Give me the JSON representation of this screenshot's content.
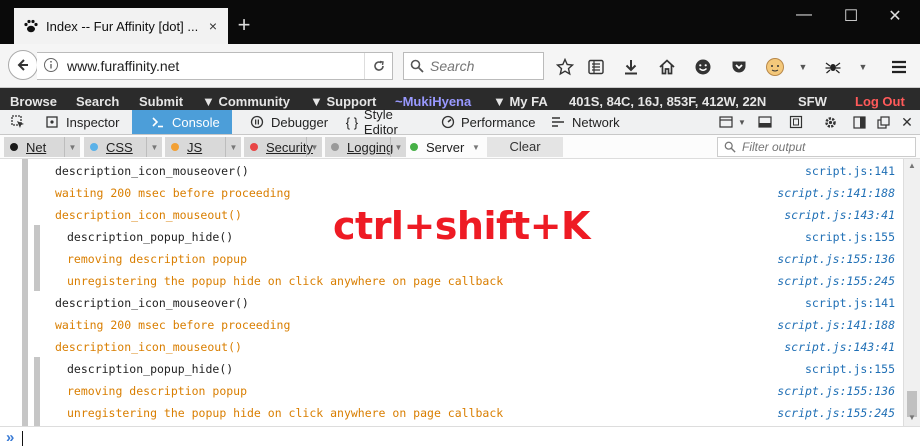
{
  "browser": {
    "tab_title": "Index -- Fur Affinity [dot] ...",
    "tab_close": "×",
    "new_tab": "+",
    "window_controls": {
      "minimize": "—",
      "maximize": "☐",
      "close": "✕"
    },
    "url": "www.furaffinity.net",
    "search_placeholder": "Search"
  },
  "site_menu": {
    "items": [
      "Browse",
      "Search",
      "Submit",
      "▼ Community",
      "▼ Support"
    ],
    "username": "~MukiHyena",
    "my_fa": "▼ My FA",
    "stats": "401S, 84C, 16J, 853F, 412W, 22N",
    "rating": "SFW",
    "logout": "Log Out"
  },
  "devtools": {
    "tabs": [
      {
        "label": "Inspector",
        "icon": "inspector-icon"
      },
      {
        "label": "Console",
        "icon": "console-icon",
        "active": true
      },
      {
        "label": "Debugger",
        "icon": "debugger-icon"
      },
      {
        "label": "Style Editor",
        "icon": "style-editor-icon"
      },
      {
        "label": "Performance",
        "icon": "performance-icon"
      },
      {
        "label": "Network",
        "icon": "network-icon"
      }
    ],
    "accent": "#4c9ed9"
  },
  "filters": {
    "buttons": [
      {
        "label": "Net",
        "color": "#1a1a1a"
      },
      {
        "label": "CSS",
        "color": "#5ab1e8"
      },
      {
        "label": "JS",
        "color": "#f2a035"
      },
      {
        "label": "Security",
        "color": "#e84545"
      },
      {
        "label": "Logging",
        "color": "#9a9a9a"
      },
      {
        "label": "Server",
        "color": "#46b046"
      }
    ],
    "clear": "Clear",
    "filter_placeholder": "Filter output"
  },
  "console": {
    "messages": [
      {
        "type": "log",
        "text": "description_icon_mouseover()",
        "loc": "script.js:141"
      },
      {
        "type": "warn",
        "text": "waiting 200 msec before proceeding",
        "loc": "script.js:141:188"
      },
      {
        "type": "warn",
        "text": "description_icon_mouseout()",
        "loc": "script.js:143:41"
      },
      {
        "type": "log",
        "text": "description_popup_hide()",
        "loc": "script.js:155"
      },
      {
        "type": "warn",
        "text": "removing description popup",
        "loc": "script.js:155:136"
      },
      {
        "type": "warn",
        "text": "unregistering the popup hide on click anywhere on page callback",
        "loc": "script.js:155:245"
      },
      {
        "type": "log",
        "text": "description_icon_mouseover()",
        "loc": "script.js:141"
      },
      {
        "type": "warn",
        "text": "waiting 200 msec before proceeding",
        "loc": "script.js:141:188"
      },
      {
        "type": "warn",
        "text": "description_icon_mouseout()",
        "loc": "script.js:143:41"
      },
      {
        "type": "log",
        "text": "description_popup_hide()",
        "loc": "script.js:155"
      },
      {
        "type": "warn",
        "text": "removing description popup",
        "loc": "script.js:155:136"
      },
      {
        "type": "warn",
        "text": "unregistering the popup hide on click anywhere on page callback",
        "loc": "script.js:155:245"
      }
    ],
    "overlay_text": "ctrl+shift+K",
    "overlay_color": "#ee1b24",
    "prompt": "»"
  }
}
